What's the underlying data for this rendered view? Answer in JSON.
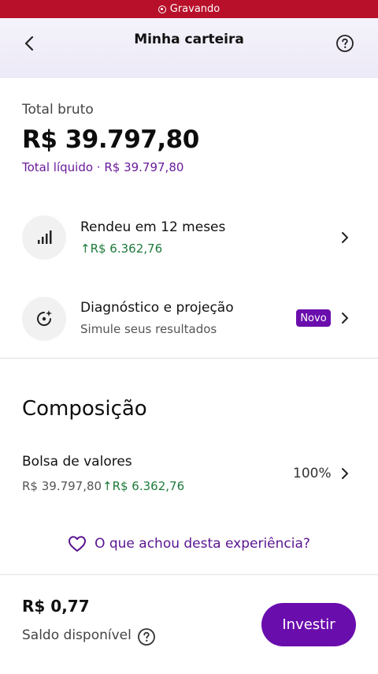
{
  "status_bar": {
    "recording_label": "Gravando"
  },
  "header": {
    "title": "Minha carteira"
  },
  "summary": {
    "total_label": "Total bruto",
    "total_value": "R$ 39.797,80",
    "net_label": "Total líquido · R$ 39.797,80"
  },
  "rows": [
    {
      "title": "Rendeu em 12 meses",
      "subtitle": "R$ 6.362,76",
      "icon": "bar-chart-icon"
    },
    {
      "title": "Diagnóstico e projeção",
      "subtitle": "Simule seus resultados",
      "badge": "Novo",
      "icon": "sparkle-target-icon"
    }
  ],
  "composition": {
    "title": "Composição",
    "items": [
      {
        "name": "Bolsa de valores",
        "value": "R$ 39.797,80",
        "gain": "R$ 6.362,76",
        "percent": "100%"
      }
    ]
  },
  "feedback": {
    "label": "O que achou desta experiência?",
    "icon": "heart-icon"
  },
  "footer": {
    "balance": "R$ 0,77",
    "balance_label": "Saldo disponível",
    "invest_label": "Investir"
  },
  "colors": {
    "accent": "#6a0dad",
    "gain": "#1e7a3c",
    "recording": "#b8102a"
  }
}
